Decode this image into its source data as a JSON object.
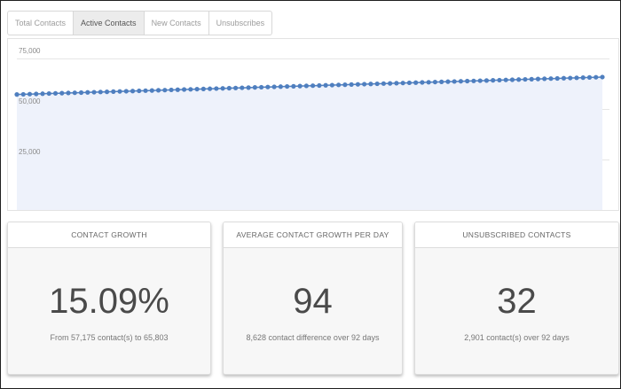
{
  "tabs": [
    {
      "label": "Total Contacts",
      "active": false
    },
    {
      "label": "Active Contacts",
      "active": true
    },
    {
      "label": "New Contacts",
      "active": false
    },
    {
      "label": "Unsubscribes",
      "active": false
    }
  ],
  "chart_data": {
    "type": "line",
    "series_count": 92,
    "y_start": 57175,
    "y_end": 65803,
    "ylim": [
      0,
      75000
    ],
    "yticks": [
      {
        "value": 75000,
        "label": "75,000"
      },
      {
        "value": 50000,
        "label": "50,000"
      },
      {
        "value": 25000,
        "label": "25,000"
      }
    ],
    "grid": true,
    "line_color": "#4f7fbf",
    "fill_color": "#eef2fb"
  },
  "cards": [
    {
      "header": "CONTACT GROWTH",
      "value": "15.09%",
      "subtext": "From 57,175 contact(s) to 65,803"
    },
    {
      "header": "AVERAGE CONTACT GROWTH PER DAY",
      "value": "94",
      "subtext": "8,628 contact difference over 92 days"
    },
    {
      "header": "UNSUBSCRIBED CONTACTS",
      "value": "32",
      "subtext": "2,901 contact(s) over 92 days"
    }
  ]
}
